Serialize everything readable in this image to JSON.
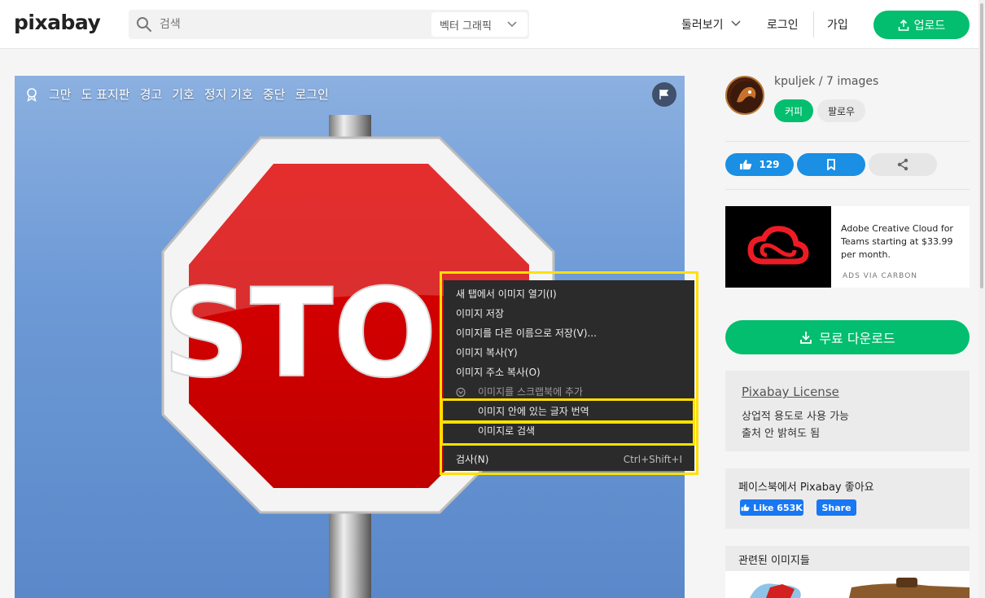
{
  "header": {
    "logo": "pixabay",
    "search_placeholder": "검색",
    "search_type": "벡터 그래픽",
    "nav_explore": "둘러보기",
    "nav_login": "로그인",
    "nav_join": "가입",
    "upload_label": "업로드"
  },
  "image": {
    "tags": [
      "그만",
      "도 표지판",
      "경고",
      "기호",
      "정지 기호",
      "중단",
      "로그인"
    ],
    "sign_text": "STOP"
  },
  "context_menu": {
    "items": [
      {
        "label": "새 탭에서 이미지 열기(I)"
      },
      {
        "label": "이미지 저장"
      },
      {
        "label": "이미지를 다른 이름으로 저장(V)..."
      },
      {
        "label": "이미지 복사(Y)"
      },
      {
        "label": "이미지 주소 복사(O)"
      },
      {
        "label": "이미지를 스크랩북에 추가"
      },
      {
        "label": "이미지 안에 있는 글자 번역"
      },
      {
        "label": "이미지로 검색"
      },
      {
        "label": "검사(N)",
        "shortcut": "Ctrl+Shift+I"
      }
    ]
  },
  "author": {
    "name_line": "kpuljek / 7 images",
    "coffee_label": "커피",
    "follow_label": "팔로우"
  },
  "actions": {
    "like_count": "129"
  },
  "ad": {
    "text": "Adobe Creative Cloud for Teams starting at $33.99 per month.",
    "via": "ADS VIA CARBON"
  },
  "download_label": "무료 다운로드",
  "license": {
    "title": "Pixabay License",
    "line1": "상업적 용도로 사용 가능",
    "line2": "출처 안 밝혀도 됨"
  },
  "facebook": {
    "title": "페이스북에서 Pixabay 좋아요",
    "like_label": "Like 653K",
    "share_label": "Share"
  },
  "related_title": "관련된 이미지들",
  "colors": {
    "brand_green": "#02be6e",
    "like_blue": "#1a8fe3",
    "highlight_yellow": "#ffe000"
  }
}
